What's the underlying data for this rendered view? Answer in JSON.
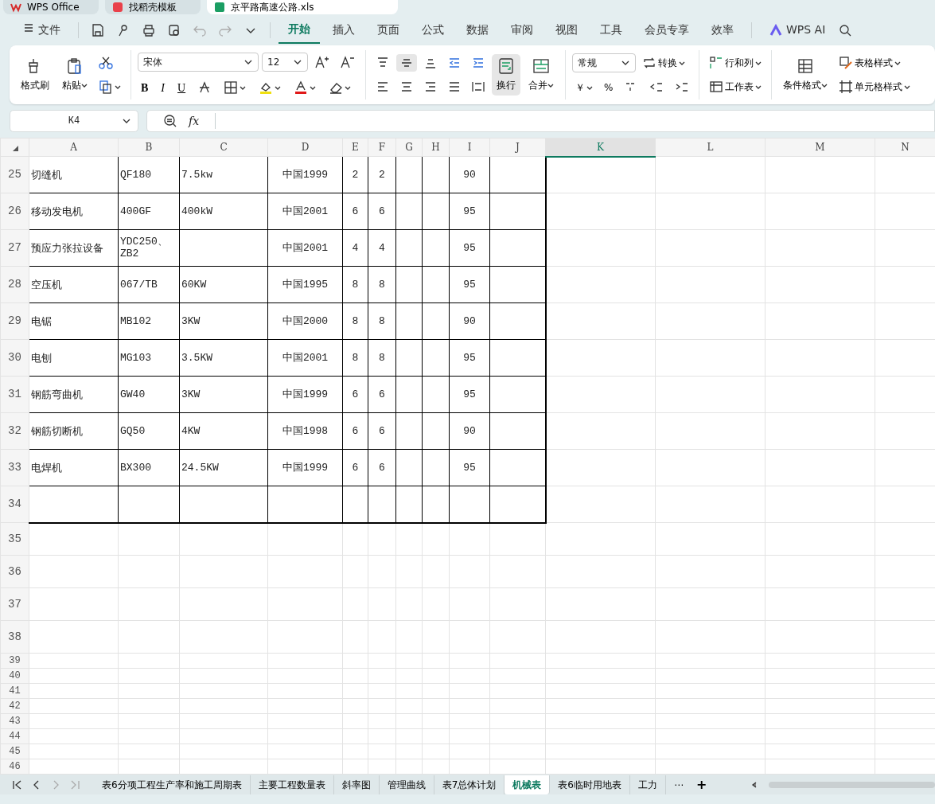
{
  "window_tabs": [
    {
      "label": "WPS Office",
      "kind": "wps",
      "selected": false
    },
    {
      "label": "找稻壳模板",
      "kind": "docer",
      "selected": false
    },
    {
      "label": "京平路高速公路.xls",
      "kind": "sheet",
      "selected": true
    }
  ],
  "menu": {
    "file": "文件",
    "tabs": [
      {
        "label": "开始",
        "selected": true
      },
      {
        "label": "插入",
        "selected": false
      },
      {
        "label": "页面",
        "selected": false
      },
      {
        "label": "公式",
        "selected": false
      },
      {
        "label": "数据",
        "selected": false
      },
      {
        "label": "审阅",
        "selected": false
      },
      {
        "label": "视图",
        "selected": false
      },
      {
        "label": "工具",
        "selected": false
      },
      {
        "label": "会员专享",
        "selected": false
      },
      {
        "label": "效率",
        "selected": false
      }
    ],
    "ai": "WPS AI"
  },
  "ribbon": {
    "format_painter": "格式刷",
    "paste": "粘贴",
    "font_name": "宋体",
    "font_size": "12",
    "styles": [
      "B",
      "I",
      "U"
    ],
    "wrap": {
      "label": "换行",
      "active": true
    },
    "merge": "合并",
    "number_format": "常规",
    "convert": "转换",
    "currency": "￥",
    "percent": "%",
    "rows_cols": "行和列",
    "worksheet": "工作表",
    "conditional": "条件格式",
    "table_style": "表格样式",
    "cell_style": "单元格样式"
  },
  "name_box": "K4",
  "function_label": "fx",
  "columns": [
    {
      "label": "A",
      "selected": false
    },
    {
      "label": "B",
      "selected": false
    },
    {
      "label": "C",
      "selected": false
    },
    {
      "label": "D",
      "selected": false
    },
    {
      "label": "E",
      "selected": false
    },
    {
      "label": "F",
      "selected": false
    },
    {
      "label": "G",
      "selected": false
    },
    {
      "label": "H",
      "selected": false
    },
    {
      "label": "I",
      "selected": false
    },
    {
      "label": "J",
      "selected": false
    },
    {
      "label": "K",
      "selected": true
    },
    {
      "label": "L",
      "selected": false
    },
    {
      "label": "M",
      "selected": false
    },
    {
      "label": "N",
      "selected": false
    }
  ],
  "rows": [
    {
      "num": "25",
      "kind": "bordered",
      "cells": {
        "A": "切缝机",
        "B": "QF180",
        "C": "7.5kw",
        "D": "中国1999",
        "E": "2",
        "F": "2",
        "I": "90"
      }
    },
    {
      "num": "26",
      "kind": "bordered",
      "cells": {
        "A": "移动发电机",
        "B": "400GF",
        "C": "400kW",
        "D": "中国2001",
        "E": "6",
        "F": "6",
        "I": "95"
      }
    },
    {
      "num": "27",
      "kind": "bordered",
      "cells": {
        "A": "预应力张拉设备",
        "B": "YDC250、ZB2",
        "D": "中国2001",
        "E": "4",
        "F": "4",
        "I": "95"
      }
    },
    {
      "num": "28",
      "kind": "bordered",
      "cells": {
        "A": "空压机",
        "B": "067/TB",
        "C": "60KW",
        "D": "中国1995",
        "E": "8",
        "F": "8",
        "I": "95"
      }
    },
    {
      "num": "29",
      "kind": "bordered",
      "cells": {
        "A": "电锯",
        "B": "MB102",
        "C": "3KW",
        "D": "中国2000",
        "E": "8",
        "F": "8",
        "I": "90"
      }
    },
    {
      "num": "30",
      "kind": "bordered",
      "cells": {
        "A": "电刨",
        "B": "MG103",
        "C": "3.5KW",
        "D": "中国2001",
        "E": "8",
        "F": "8",
        "I": "95"
      }
    },
    {
      "num": "31",
      "kind": "bordered",
      "cells": {
        "A": "钢筋弯曲机",
        "B": "GW40",
        "C": "3KW",
        "D": "中国1999",
        "E": "6",
        "F": "6",
        "I": "95"
      }
    },
    {
      "num": "32",
      "kind": "bordered",
      "cells": {
        "A": "钢筋切断机",
        "B": "GQ50",
        "C": "4KW",
        "D": "中国1998",
        "E": "6",
        "F": "6",
        "I": "90"
      }
    },
    {
      "num": "33",
      "kind": "bordered",
      "cells": {
        "A": "电焊机",
        "B": "BX300",
        "C": "24.5KW",
        "D": "中国1999",
        "E": "6",
        "F": "6",
        "I": "95"
      }
    },
    {
      "num": "34",
      "kind": "bordered"
    },
    {
      "num": "35",
      "kind": "plain"
    },
    {
      "num": "36",
      "kind": "plain"
    },
    {
      "num": "37",
      "kind": "plain"
    },
    {
      "num": "38",
      "kind": "plain"
    },
    {
      "num": "39",
      "kind": "plain"
    },
    {
      "num": "40",
      "kind": "plain"
    },
    {
      "num": "41",
      "kind": "plain"
    },
    {
      "num": "42",
      "kind": "plain"
    },
    {
      "num": "43",
      "kind": "plain"
    },
    {
      "num": "44",
      "kind": "plain"
    },
    {
      "num": "45",
      "kind": "plain"
    },
    {
      "num": "46",
      "kind": "plain"
    }
  ],
  "sheet_tabs": [
    {
      "label": "表6分项工程生产率和施工周期表",
      "selected": false
    },
    {
      "label": "主要工程数量表",
      "selected": false
    },
    {
      "label": "斜率图",
      "selected": false
    },
    {
      "label": "管理曲线",
      "selected": false
    },
    {
      "label": "表7总体计划",
      "selected": false
    },
    {
      "label": "机械表",
      "selected": true
    },
    {
      "label": "表6临时用地表",
      "selected": false
    },
    {
      "label": "工力",
      "selected": false
    }
  ],
  "more_sheets": "⋯",
  "add_sheet": "+"
}
